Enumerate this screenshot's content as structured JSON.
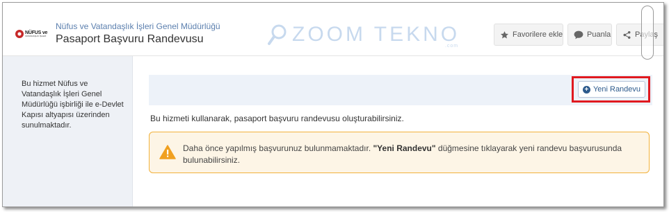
{
  "header": {
    "logo": {
      "line1": "NÜFUS ve",
      "line2": "VATANDAŞLIK İŞLERİ"
    },
    "org_name": "Nüfus ve Vatandaşlık İşleri Genel Müdürlüğü",
    "service_title": "Pasaport Başvuru Randevusu",
    "watermark": {
      "text": "ZOOM TEKNO",
      "sub": ".com"
    },
    "actions": {
      "favorite": "Favorilere ekle",
      "rate": "Puanla",
      "share": "Paylaş"
    }
  },
  "sidebar": {
    "description": "Bu hizmet Nüfus ve Vatandaşlık İşleri Genel Müdürlüğü işbirliği ile e-Devlet Kapısı altyapısı üzerinden sunulmaktadır."
  },
  "main": {
    "new_appointment_label": "Yeni Randevu",
    "intro_text": "Bu hizmeti kullanarak, pasaport başvuru randevusu oluşturabilirsiniz.",
    "alert": {
      "before": "Daha önce yapılmış başvurunuz bulunmamaktadır. ",
      "emphasis": "\"Yeni Randevu\"",
      "after": " düğmesine tıklayarak yeni randevu başvurusunda bulunabilirsiniz."
    }
  },
  "colors": {
    "accent": "#2d5a8c",
    "highlight_border": "#e0191f",
    "alert_border": "#f2b13a",
    "alert_bg": "#fdf5e6",
    "warning_icon": "#f0a020"
  },
  "icons": {
    "favorite": "star-icon",
    "rate": "speech-bubble-icon",
    "share": "share-icon",
    "new_appointment": "plus-circle-icon",
    "alert": "warning-triangle-icon",
    "watermark": "magnifier-icon"
  }
}
